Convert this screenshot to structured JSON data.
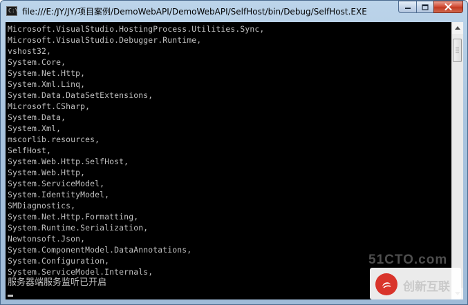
{
  "window": {
    "title": "file:///E:/JY/JY/项目案例/DemoWebAPI/DemoWebAPI/SelfHost/bin/Debug/SelfHost.EXE",
    "app_icon_text": "C:\\",
    "buttons": {
      "minimize_icon": "minimize-icon",
      "maximize_icon": "maximize-icon",
      "close_icon": "close-icon"
    }
  },
  "console": {
    "lines": [
      "Microsoft.VisualStudio.HostingProcess.Utilities.Sync,",
      "Microsoft.VisualStudio.Debugger.Runtime,",
      "vshost32,",
      "System.Core,",
      "System.Net.Http,",
      "System.Xml.Linq,",
      "System.Data.DataSetExtensions,",
      "Microsoft.CSharp,",
      "System.Data,",
      "System.Xml,",
      "mscorlib.resources,",
      "SelfHost,",
      "System.Web.Http.SelfHost,",
      "System.Web.Http,",
      "System.ServiceModel,",
      "System.IdentityModel,",
      "SMDiagnostics,",
      "System.Net.Http.Formatting,",
      "System.Runtime.Serialization,",
      "Newtonsoft.Json,",
      "System.ComponentModel.DataAnnotations,",
      "System.Configuration,",
      "System.ServiceModel.Internals,"
    ],
    "status": "服务器端服务监听已开启",
    "text_color": "#c0c0c0",
    "background": "#000000"
  },
  "watermark": {
    "site": "51CTO.com",
    "brand": "创新互联"
  }
}
